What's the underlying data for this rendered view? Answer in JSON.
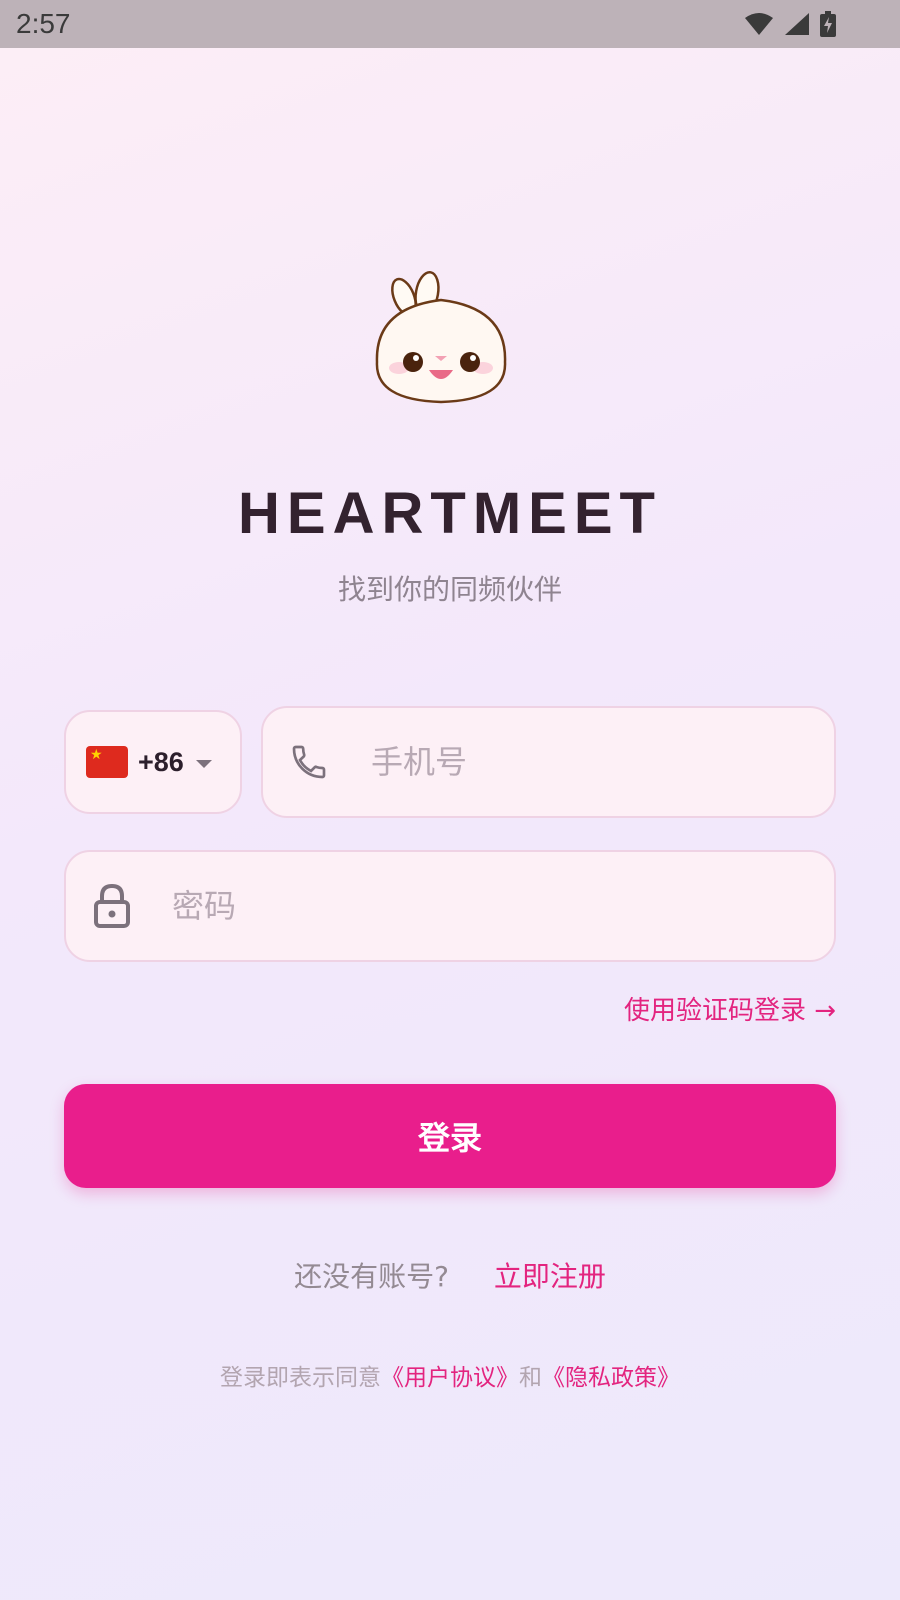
{
  "status_bar": {
    "time": "2:57",
    "icons": [
      "wifi-icon",
      "signal-icon",
      "battery-icon"
    ]
  },
  "brand": {
    "title": "HEARTMEET",
    "subtitle": "找到你的同频伙伴",
    "mascot_icon": "bunny-mascot-icon"
  },
  "form": {
    "country_code": "+86",
    "country_flag": "china-flag-icon",
    "phone_placeholder": "手机号",
    "password_placeholder": "密码",
    "alt_login_label": "使用验证码登录 →",
    "login_label": "登录"
  },
  "register": {
    "question": "还没有账号?",
    "link": "立即注册"
  },
  "agreement": {
    "prefix": "登录即表示同意",
    "user_agreement": "《用户协议》",
    "and": "和",
    "privacy_policy": "《隐私政策》"
  },
  "colors": {
    "accent": "#e91e8c",
    "field_bg": "#fdf0f6",
    "field_border": "#efd2e4"
  }
}
